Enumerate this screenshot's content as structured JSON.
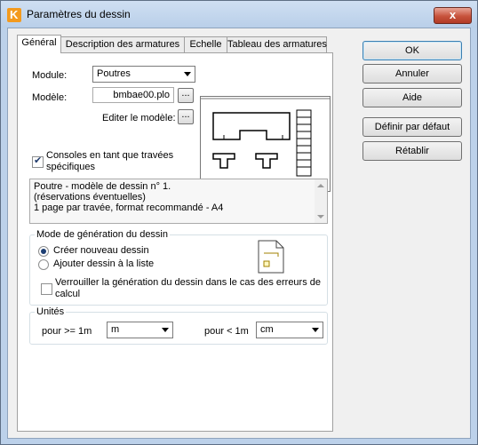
{
  "window": {
    "title": "Paramètres du dessin",
    "close_label": "x"
  },
  "tabs": [
    {
      "label": "Général"
    },
    {
      "label": "Description des armatures"
    },
    {
      "label": "Echelle"
    },
    {
      "label": "Tableau des armatures"
    }
  ],
  "general": {
    "module_label": "Module:",
    "module_value": "Poutres",
    "model_label": "Modèle:",
    "model_value": "bmbae00.plo",
    "browse_label": "...",
    "edit_model_label": "Editer le modèle:",
    "edit_button_label": "...",
    "consoles_label_line1": "Consoles en tant que travées",
    "consoles_label_line2": "spécifiques",
    "consoles_checked": true,
    "description_lines": [
      "Poutre - modèle de dessin n° 1.",
      "(réservations éventuelles)",
      "1 page par travée, format recommandé - A4"
    ]
  },
  "generation": {
    "group_label": "Mode de génération du dessin",
    "create_label": "Créer nouveau dessin",
    "add_label": "Ajouter dessin à la liste",
    "selected": "create",
    "lock_label_line1": "Verrouiller la génération du dessin dans le cas des erreurs de",
    "lock_label_line2": "calcul",
    "lock_checked": false
  },
  "units": {
    "group_label": "Unités",
    "ge_label": "pour >= 1m",
    "ge_value": "m",
    "lt_label": "pour < 1m",
    "lt_value": "cm"
  },
  "buttons": {
    "ok": "OK",
    "cancel": "Annuler",
    "help": "Aide",
    "set_default": "Définir par défaut",
    "restore": "Rétablir"
  }
}
